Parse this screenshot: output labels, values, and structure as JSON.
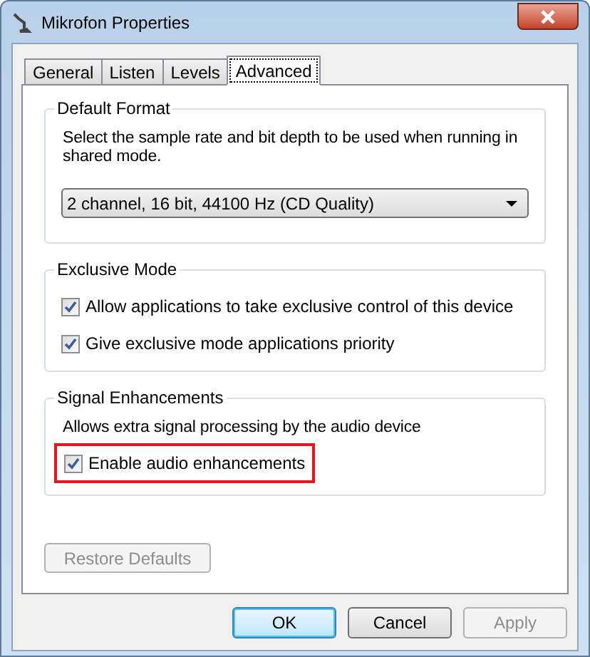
{
  "window": {
    "title": "Mikrofon Properties"
  },
  "tabs": [
    {
      "label": "General",
      "selected": false
    },
    {
      "label": "Listen",
      "selected": false
    },
    {
      "label": "Levels",
      "selected": false
    },
    {
      "label": "Advanced",
      "selected": true
    }
  ],
  "groups": [
    {
      "title": "Default Format",
      "description": "Select the sample rate and bit depth to be used when running in shared mode.",
      "dropdown": {
        "value": "2 channel, 16 bit, 44100 Hz (CD Quality)"
      }
    },
    {
      "title": "Exclusive Mode",
      "checkboxes": [
        {
          "label": "Allow applications to take exclusive control of this device",
          "checked": true,
          "highlighted": false
        },
        {
          "label": "Give exclusive mode applications priority",
          "checked": true,
          "highlighted": false
        }
      ]
    },
    {
      "title": "Signal Enhancements",
      "description": "Allows extra signal processing by the audio device",
      "checkboxes": [
        {
          "label": "Enable audio enhancements",
          "checked": true,
          "highlighted": true
        }
      ]
    }
  ],
  "restore_button": {
    "label": "Restore Defaults",
    "disabled": true
  },
  "buttons": [
    {
      "label": "OK",
      "default": true,
      "disabled": false
    },
    {
      "label": "Cancel",
      "default": false,
      "disabled": false
    },
    {
      "label": "Apply",
      "default": false,
      "disabled": true
    }
  ]
}
